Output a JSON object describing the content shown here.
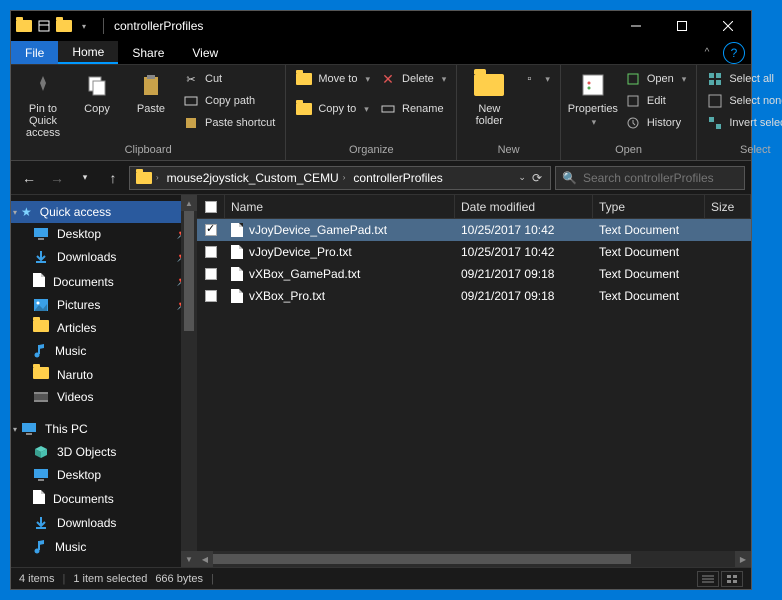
{
  "title": "controllerProfiles",
  "menutabs": {
    "file": "File",
    "home": "Home",
    "share": "Share",
    "view": "View"
  },
  "ribbon": {
    "clipboard": {
      "pin": "Pin to Quick\naccess",
      "copy": "Copy",
      "paste": "Paste",
      "cut": "Cut",
      "copypath": "Copy path",
      "pasteshortcut": "Paste shortcut",
      "label": "Clipboard"
    },
    "organize": {
      "moveto": "Move to",
      "copyto": "Copy to",
      "delete": "Delete",
      "rename": "Rename",
      "label": "Organize"
    },
    "new": {
      "newfolder": "New\nfolder",
      "label": "New"
    },
    "open": {
      "properties": "Properties",
      "open": "Open",
      "edit": "Edit",
      "history": "History",
      "label": "Open"
    },
    "select": {
      "selectall": "Select all",
      "selectnone": "Select none",
      "invert": "Invert selection",
      "label": "Select"
    }
  },
  "breadcrumb": {
    "seg1": "mouse2joystick_Custom_CEMU",
    "seg2": "controllerProfiles"
  },
  "search": {
    "placeholder": "Search controllerProfiles"
  },
  "sidebar": {
    "quickaccess": "Quick access",
    "items1": [
      "Desktop",
      "Downloads",
      "Documents",
      "Pictures",
      "Articles",
      "Music",
      "Naruto",
      "Videos"
    ],
    "thispc": "This PC",
    "items2": [
      "3D Objects",
      "Desktop",
      "Documents",
      "Downloads",
      "Music"
    ]
  },
  "columns": {
    "name": "Name",
    "date": "Date modified",
    "type": "Type",
    "size": "Size"
  },
  "files": [
    {
      "name": "vJoyDevice_GamePad.txt",
      "date": "10/25/2017 10:42",
      "type": "Text Document",
      "selected": true
    },
    {
      "name": "vJoyDevice_Pro.txt",
      "date": "10/25/2017 10:42",
      "type": "Text Document",
      "selected": false
    },
    {
      "name": "vXBox_GamePad.txt",
      "date": "09/21/2017 09:18",
      "type": "Text Document",
      "selected": false
    },
    {
      "name": "vXBox_Pro.txt",
      "date": "09/21/2017 09:18",
      "type": "Text Document",
      "selected": false
    }
  ],
  "status": {
    "count": "4 items",
    "selected": "1 item selected",
    "size": "666 bytes"
  },
  "sidebar_icons": {
    "Desktop": "monitor-blue",
    "Downloads": "download-blue",
    "Documents": "doc",
    "Pictures": "picture",
    "Articles": "folder",
    "Music": "music",
    "Naruto": "folder",
    "Videos": "video",
    "3D Objects": "cube",
    "This PC": "monitor-blue",
    "Quick access": "star"
  }
}
